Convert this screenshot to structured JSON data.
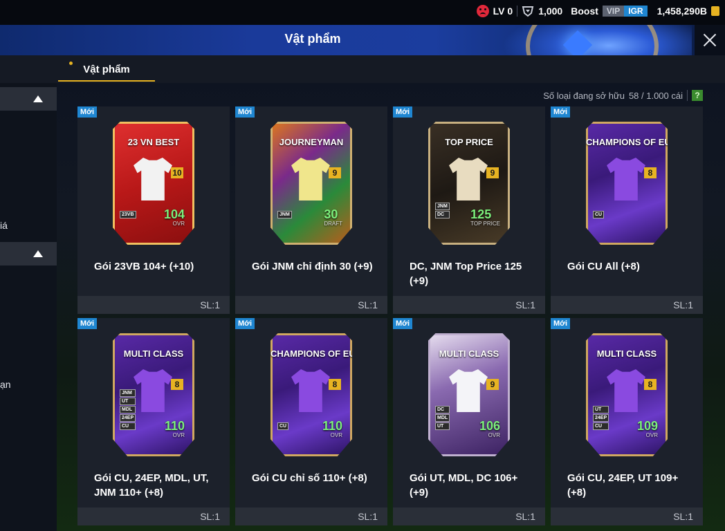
{
  "status": {
    "level": "LV 0",
    "points": "1,000",
    "boost": "Boost",
    "vip": "VIP",
    "igr": "IGR",
    "currency": "1,458,290B"
  },
  "title": "Vật phẩm",
  "tab": {
    "label": "Vật phẩm"
  },
  "sidebar": {
    "texts": [
      "iá",
      "ạn"
    ]
  },
  "inventory": {
    "label": "Số loại đang sở hữu",
    "count": "58 / 1.000 cái",
    "help": "?"
  },
  "colors": {
    "accent": "#e7b322",
    "new_badge": "#1f86d1",
    "ovr_green": "#7cf07c"
  },
  "cards": [
    {
      "badge": "Mới",
      "name": "Gói 23VB 104+ (+10)",
      "qty": "SL:1",
      "kit_title": "23 VN BEST",
      "kit_level": "10",
      "ovr": "104",
      "ovr_label": "OVR",
      "tags": [
        "23VB"
      ],
      "theme": "red"
    },
    {
      "badge": "Mới",
      "name": "Gói JNM chỉ định 30 (+9)",
      "qty": "SL:1",
      "kit_title": "JOURNEYMAN",
      "kit_level": "9",
      "ovr": "30",
      "ovr_label": "DRAFT",
      "tags": [
        "JNM"
      ],
      "theme": "journey"
    },
    {
      "badge": "Mới",
      "name": "DC, JNM Top Price 125 (+9)",
      "qty": "SL:1",
      "kit_title": "TOP PRICE",
      "kit_level": "9",
      "ovr": "125",
      "ovr_label": "TOP PRICE",
      "tags": [
        "JNM",
        "DC"
      ],
      "theme": "gold"
    },
    {
      "badge": "Mới",
      "name": "Gói CU All (+8)",
      "qty": "SL:1",
      "kit_title": "CHAMPIONS OF EUROPE",
      "kit_level": "8",
      "ovr": "",
      "ovr_label": "",
      "tags": [
        "CU"
      ],
      "theme": "purple"
    },
    {
      "badge": "Mới",
      "name": "Gói CU, 24EP, MDL, UT, JNM 110+ (+8)",
      "qty": "SL:1",
      "kit_title": "MULTI CLASS",
      "kit_level": "8",
      "ovr": "110",
      "ovr_label": "OVR",
      "tags": [
        "JNM",
        "UT",
        "MDL",
        "24EP",
        "CU"
      ],
      "theme": "purple"
    },
    {
      "badge": "Mới",
      "name": "Gói CU chỉ số 110+ (+8)",
      "qty": "SL:1",
      "kit_title": "CHAMPIONS OF EUROPE",
      "kit_level": "8",
      "ovr": "110",
      "ovr_label": "OVR",
      "tags": [
        "CU"
      ],
      "theme": "purple"
    },
    {
      "badge": "Mới",
      "name": "Gói UT, MDL, DC 106+ (+9)",
      "qty": "SL:1",
      "kit_title": "MULTI CLASS",
      "kit_level": "9",
      "ovr": "106",
      "ovr_label": "OVR",
      "tags": [
        "DC",
        "MDL",
        "UT"
      ],
      "theme": "white"
    },
    {
      "badge": "Mới",
      "name": "Gói CU, 24EP, UT 109+ (+8)",
      "qty": "SL:1",
      "kit_title": "MULTI CLASS",
      "kit_level": "8",
      "ovr": "109",
      "ovr_label": "OVR",
      "tags": [
        "UT",
        "24EP",
        "CU"
      ],
      "theme": "purple"
    }
  ]
}
